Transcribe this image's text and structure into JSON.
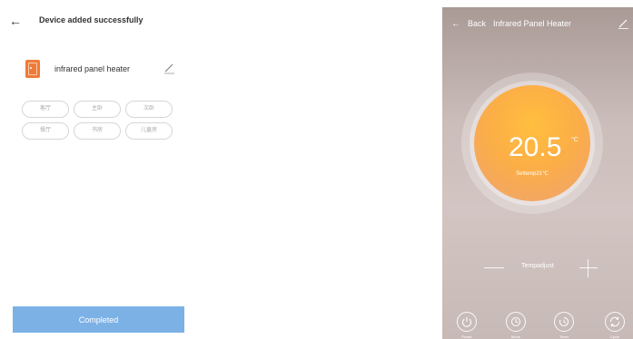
{
  "left_page": {
    "header": {
      "back_icon": "back-arrow-icon",
      "title": "Device added successfully"
    },
    "device": {
      "icon": "heater-device-icon",
      "name": "infrared panel heater",
      "edit_icon": "pencil-icon"
    },
    "rooms": [
      "客厅",
      "主卧",
      "次卧",
      "餐厅",
      "书房",
      "儿童房"
    ],
    "completed_button": "Completed"
  },
  "right_page": {
    "header": {
      "back_icon": "back-arrow-icon",
      "back_label": "Back",
      "title": "Infrared Panel Heater",
      "edit_icon": "pencil-icon"
    },
    "dial": {
      "temperature": "20.5",
      "unit": "°C",
      "set_temp_label": "Settemp21℃"
    },
    "adjust": {
      "label": "Tempadjust",
      "minus_icon": "minus-icon",
      "plus_icon": "plus-icon"
    },
    "controls": [
      {
        "icon": "power-icon",
        "label": "Power"
      },
      {
        "icon": "clock-icon",
        "label": "Mode"
      },
      {
        "icon": "timer-icon",
        "label": "Timer"
      },
      {
        "icon": "refresh-icon",
        "label": "Cycle"
      }
    ]
  },
  "colors": {
    "accent_orange": "#fcae46",
    "device_icon_orange": "#f07a3a",
    "completed_button_blue": "#7cb1e6",
    "panel_background": "#cbbdb9"
  }
}
